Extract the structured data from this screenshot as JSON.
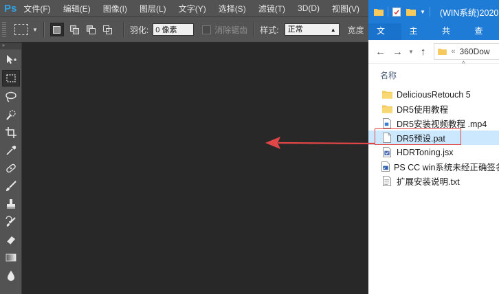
{
  "photoshop": {
    "logo": "Ps",
    "menus": [
      "文件(F)",
      "编辑(E)",
      "图像(I)",
      "图层(L)",
      "文字(Y)",
      "选择(S)",
      "滤镜(T)",
      "3D(D)",
      "视图(V)"
    ],
    "options": {
      "feather_label": "羽化:",
      "feather_value": "0 像素",
      "antialias_label": "消除锯齿",
      "style_label": "样式:",
      "style_value": "正常",
      "width_label": "宽度"
    },
    "tools": [
      "move-tool",
      "marquee-tool",
      "lasso-tool",
      "quick-select-tool",
      "crop-tool",
      "eyedropper-tool",
      "healing-brush-tool",
      "brush-tool",
      "clone-stamp-tool",
      "history-brush-tool",
      "eraser-tool",
      "gradient-tool",
      "blur-tool"
    ]
  },
  "explorer": {
    "title": "(WIN系统)2020",
    "ribbon_tabs": [
      "文件",
      "主页",
      "共享",
      "查看"
    ],
    "address": "360Dow",
    "column_name": "名称",
    "files": [
      {
        "name": "DeliciousRetouch 5",
        "icon": "folder-icon"
      },
      {
        "name": "DR5使用教程",
        "icon": "folder-icon"
      },
      {
        "name": "DR5安装视频教程 .mp4",
        "icon": "video-file-icon"
      },
      {
        "name": "DR5预设.pat",
        "icon": "document-icon",
        "selected": true
      },
      {
        "name": "HDRToning.jsx",
        "icon": "script-file-icon"
      },
      {
        "name": "PS CC  win系统未经正确签名",
        "icon": "shortcut-file-icon"
      },
      {
        "name": "扩展安装说明.txt",
        "icon": "text-file-icon"
      }
    ]
  },
  "colors": {
    "ps_panel": "#535353",
    "ps_canvas": "#282828",
    "explorer_accent": "#1e7cd6",
    "selection": "#cce8ff",
    "annotation_red": "#e24646"
  }
}
